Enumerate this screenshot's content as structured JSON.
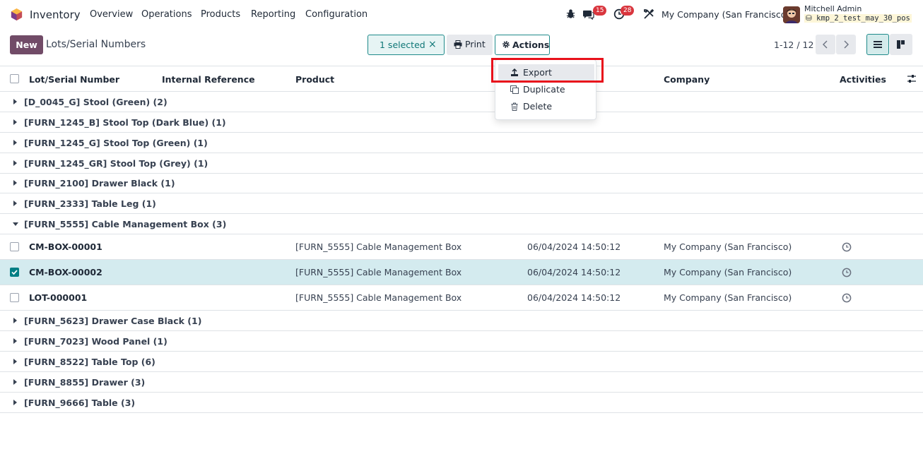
{
  "nav": {
    "app_name": "Inventory",
    "menu": [
      "Overview",
      "Operations",
      "Products",
      "Reporting",
      "Configuration"
    ],
    "messages_badge": "15",
    "activities_badge": "28",
    "company": "My Company (San Francisco)",
    "user_name": "Mitchell Admin",
    "db_name": "kmp_2_test_may_30_pos"
  },
  "control": {
    "new_label": "New",
    "title": "Lots/Serial Numbers",
    "selected_label": "1 selected",
    "clear_symbol": "×",
    "print_label": "Print",
    "actions_label": "Actions",
    "pager": "1-12 / 12"
  },
  "columns": {
    "lot": "Lot/Serial Number",
    "internal_ref": "Internal Reference",
    "product": "Product",
    "company": "Company",
    "activities": "Activities"
  },
  "groups_before": [
    "[D_0045_G] Stool (Green) (2)",
    "[FURN_1245_B] Stool Top (Dark Blue) (1)",
    "[FURN_1245_G] Stool Top (Green) (1)",
    "[FURN_1245_GR] Stool Top (Grey) (1)",
    "[FURN_2100] Drawer Black (1)",
    "[FURN_2333] Table Leg (1)"
  ],
  "open_group": "[FURN_5555] Cable Management Box (3)",
  "rows": [
    {
      "lot": "CM-BOX-00001",
      "product": "[FURN_5555] Cable Management Box",
      "date": "06/04/2024 14:50:12",
      "company": "My Company (San Francisco)",
      "selected": false
    },
    {
      "lot": "CM-BOX-00002",
      "product": "[FURN_5555] Cable Management Box",
      "date": "06/04/2024 14:50:12",
      "company": "My Company (San Francisco)",
      "selected": true
    },
    {
      "lot": "LOT-000001",
      "product": "[FURN_5555] Cable Management Box",
      "date": "06/04/2024 14:50:12",
      "company": "My Company (San Francisco)",
      "selected": false
    }
  ],
  "groups_after": [
    "[FURN_5623] Drawer Case Black (1)",
    "[FURN_7023] Wood Panel (1)",
    "[FURN_8522] Table Top (6)",
    "[FURN_8855] Drawer (3)",
    "[FURN_9666] Table (3)"
  ],
  "actions_menu": {
    "export": "Export",
    "duplicate": "Duplicate",
    "delete": "Delete"
  },
  "colors": {
    "brand": "#714b67",
    "accent": "#017e84",
    "highlight": "#e8111b"
  }
}
